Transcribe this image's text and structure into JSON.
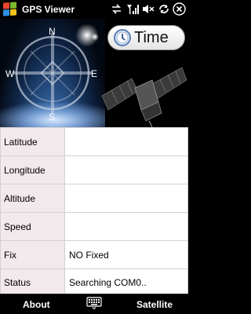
{
  "app": {
    "title": "GPS Viewer"
  },
  "status_icons": [
    "data-transfer-icon",
    "signal-icon",
    "volume-muted-icon",
    "sync-icon",
    "close-icon"
  ],
  "compass": {
    "north": "N",
    "west": "W",
    "east": "E",
    "south": "S"
  },
  "header": {
    "time_button_label": "Time"
  },
  "table": {
    "rows": [
      {
        "label": "Latitude",
        "value": ""
      },
      {
        "label": "Longitude",
        "value": ""
      },
      {
        "label": "Altitude",
        "value": ""
      },
      {
        "label": "Speed",
        "value": ""
      },
      {
        "label": "Fix",
        "value": "NO Fixed"
      },
      {
        "label": "Status",
        "value": "Searching COM0.."
      }
    ]
  },
  "softkeys": {
    "left": "About",
    "right": "Satellite",
    "center_icon": "keyboard-icon"
  },
  "colors": {
    "table_label_bg": "#f2e9ec",
    "panel_blue": "#2f5d97",
    "background": "#000000"
  }
}
